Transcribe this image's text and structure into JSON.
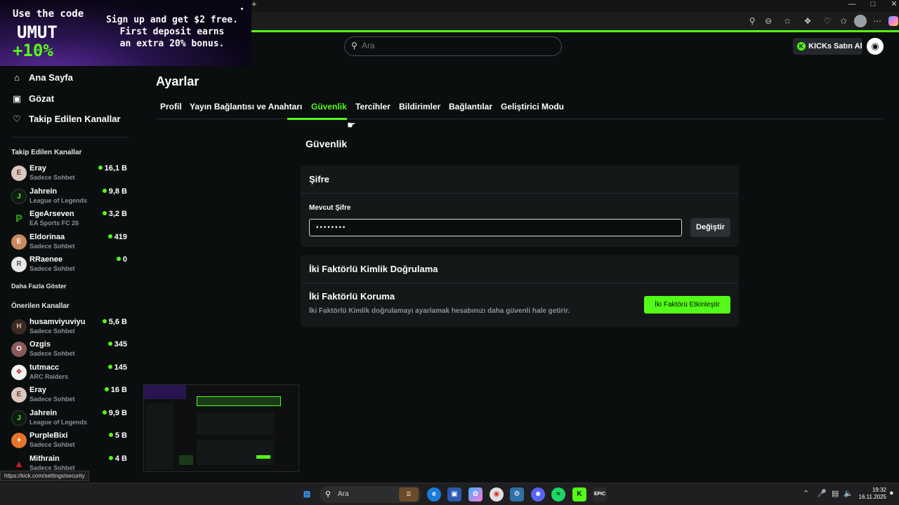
{
  "ad": {
    "code_label": "Use the code",
    "code_value": "UMUT",
    "bonus_pct": "+10%",
    "promo_line1": "Sign up and get $2 free.",
    "promo_line2": "First deposit earns",
    "promo_line3": "an extra 20% bonus."
  },
  "header": {
    "search_placeholder": "Ara",
    "kicks_label": "KICKs Satın Al",
    "avatar_icon": "user-avatar"
  },
  "sidebar": {
    "nav": [
      {
        "label": "Ana Sayfa",
        "icon": "home-icon"
      },
      {
        "label": "Gözat",
        "icon": "browse-icon"
      },
      {
        "label": "Takip Edilen Kanallar",
        "icon": "heart-icon"
      }
    ],
    "followed_title": "Takip Edilen Kanallar",
    "followed": [
      {
        "name": "Eray",
        "category": "Sadece Sohbet",
        "viewers": "16,1 B"
      },
      {
        "name": "Jahrein",
        "category": "League of Legends",
        "viewers": "9,8 B"
      },
      {
        "name": "EgeArseven",
        "category": "EA Sports FC 26",
        "viewers": "3,2 B"
      },
      {
        "name": "Eldorinaa",
        "category": "Sadece Sohbet",
        "viewers": "419"
      },
      {
        "name": "RRaenee",
        "category": "Sadece Sohbet",
        "viewers": "0"
      }
    ],
    "show_more": "Daha Fazla Göster",
    "recommended_title": "Önerilen Kanallar",
    "recommended": [
      {
        "name": "husamviyuviyu",
        "category": "Sadece Sohbet",
        "viewers": "5,6 B"
      },
      {
        "name": "Ozgis",
        "category": "Sadece Sohbet",
        "viewers": "345"
      },
      {
        "name": "tutmacc",
        "category": "ARC Raiders",
        "viewers": "145"
      },
      {
        "name": "Eray",
        "category": "Sadece Sohbet",
        "viewers": "16 B"
      },
      {
        "name": "Jahrein",
        "category": "League of Legends",
        "viewers": "9,9 B"
      },
      {
        "name": "PurpleBixi",
        "category": "Sadece Sohbet",
        "viewers": "5 B"
      },
      {
        "name": "Mithrain",
        "category": "Sadece Sohbet",
        "viewers": "4 B"
      }
    ]
  },
  "main": {
    "page_title": "Ayarlar",
    "tabs": [
      {
        "label": "Profil",
        "active": false
      },
      {
        "label": "Yayın Bağlantısı ve Anahtarı",
        "active": false
      },
      {
        "label": "Güvenlik",
        "active": true
      },
      {
        "label": "Tercihler",
        "active": false
      },
      {
        "label": "Bildirimler",
        "active": false
      },
      {
        "label": "Bağlantılar",
        "active": false
      },
      {
        "label": "Geliştirici Modu",
        "active": false
      }
    ],
    "section_title": "Güvenlik",
    "password_card": {
      "title": "Şifre",
      "field_label": "Mevcut Şifre",
      "field_value": "••••••••",
      "change_button": "Değiştir"
    },
    "tfa_card": {
      "title": "İki Faktörlü Kimlik Doğrulama",
      "sub_title": "İki Faktörlü Koruma",
      "description": "İki Faktörlü Kimlik doğrulamayı ayarlamak hesabınızı daha güvenli hale getirir.",
      "enable_button": "İki Faktörü Etkinleştir"
    }
  },
  "status_url": "https://kick.com/settings/security",
  "taskbar": {
    "search_placeholder": "Ara",
    "time": "19:32",
    "date": "16.11.2025"
  },
  "colors": {
    "accent": "#53fc18",
    "background": "#0b0e0f",
    "card": "#151819"
  }
}
